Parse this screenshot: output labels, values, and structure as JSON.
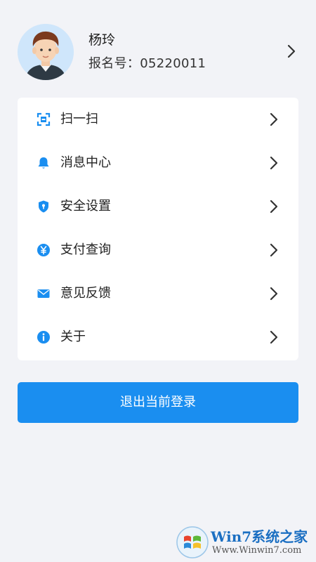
{
  "profile": {
    "name": "杨玲",
    "registration": "报名号：05220011"
  },
  "menu": {
    "items": [
      {
        "label": "扫一扫",
        "icon": "scan-icon"
      },
      {
        "label": "消息中心",
        "icon": "bell-icon"
      },
      {
        "label": "安全设置",
        "icon": "shield-icon"
      },
      {
        "label": "支付查询",
        "icon": "yuan-icon"
      },
      {
        "label": "意见反馈",
        "icon": "mail-icon"
      },
      {
        "label": "关于",
        "icon": "info-icon"
      }
    ]
  },
  "logout": {
    "label": "退出当前登录"
  },
  "watermark": {
    "brand": "Win7系统之家",
    "url": "Www.Winwin7.com"
  },
  "colors": {
    "accent": "#1a8ef0",
    "background": "#f2f3f7",
    "card": "#ffffff"
  }
}
